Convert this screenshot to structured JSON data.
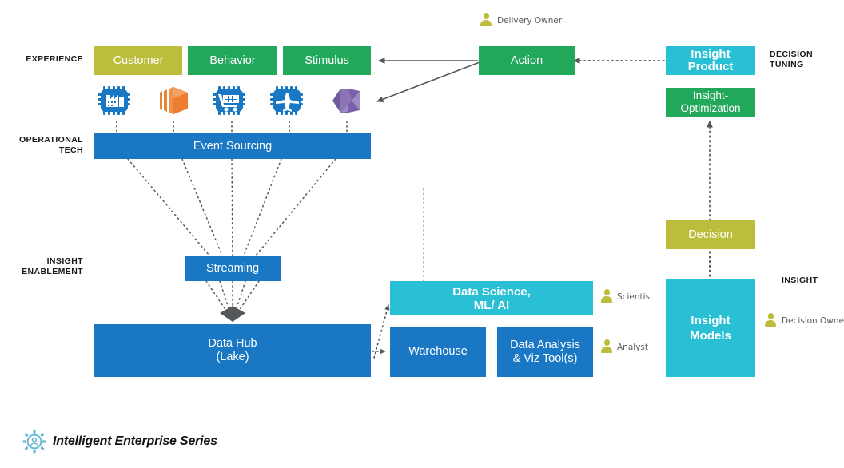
{
  "diagram": {
    "title": "Intelligent Enterprise Series",
    "brand_icon": "gear-person-icon"
  },
  "section_labels": {
    "experience": "EXPERIENCE",
    "operational_tech": "OPERATIONAL\nTECH",
    "insight_enablement": "INSIGHT\nENABLEMENT",
    "decision_tuning": "DECISION\nTUNING",
    "insight": "INSIGHT"
  },
  "experience_row": {
    "customer": "Customer",
    "behavior": "Behavior",
    "stimulus": "Stimulus",
    "action": "Action"
  },
  "tech_icons": [
    {
      "name": "factory-chip-icon",
      "color": "#1a77c4"
    },
    {
      "name": "aws-hexagon-icon",
      "color": "#ed7d31"
    },
    {
      "name": "shopping-cart-chip-icon",
      "color": "#1a77c4"
    },
    {
      "name": "airplane-chip-icon",
      "color": "#1a77c4"
    },
    {
      "name": "azure-hexagon-icon",
      "color": "#7c5fa8"
    }
  ],
  "operational": {
    "event_sourcing": "Event Sourcing"
  },
  "enablement": {
    "streaming": "Streaming",
    "data_hub": "Data Hub\n(Lake)",
    "data_hub_line1": "Data Hub",
    "data_hub_line2": "(Lake)",
    "data_science_line1": "Data Science,",
    "data_science_line2": "ML/ AI",
    "warehouse": "Warehouse",
    "data_analysis_line1": "Data Analysis",
    "data_analysis_line2": "& Viz Tool(s)"
  },
  "right_column": {
    "insight_product_line1": "Insight",
    "insight_product_line2": "Product",
    "insight_optimization_line1": "Insight-",
    "insight_optimization_line2": "Optimization",
    "decision": "Decision",
    "insight_models_line1": "Insight",
    "insight_models_line2": "Models"
  },
  "personas": {
    "delivery_owner": "Delivery Owner",
    "scientist": "Scientist",
    "analyst": "Analyst",
    "decision_owner": "Decision Owner"
  },
  "colors": {
    "olive": "#bdbd3c",
    "green": "#22a85a",
    "blue": "#1a77c4",
    "cyan": "#29bfd4",
    "orange": "#ed7d31",
    "purple": "#7c5fa8",
    "arrow_gray": "#55585a",
    "divider_gray": "#9a9a9a",
    "brand_gear": "#6cb9d4"
  }
}
